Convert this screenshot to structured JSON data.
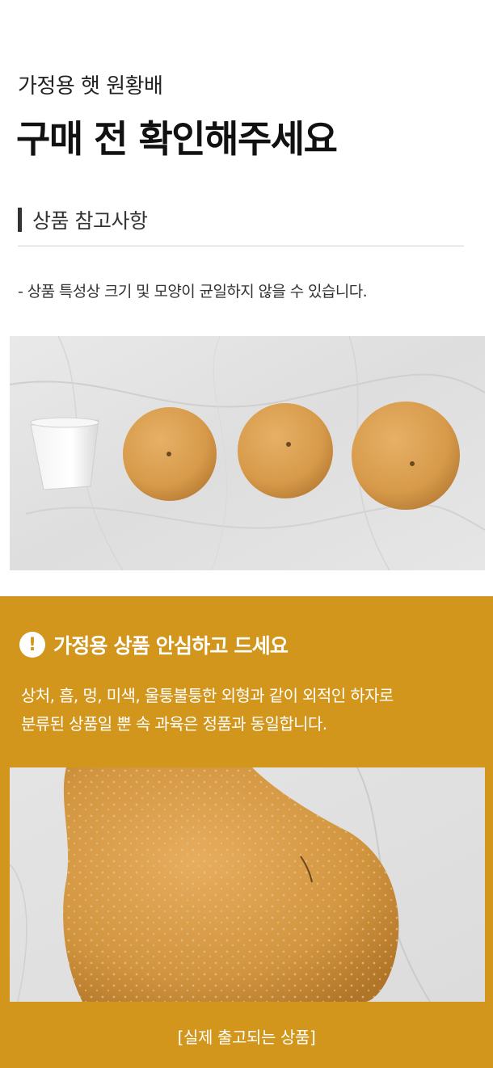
{
  "header": {
    "subtitle": "가정용 햇 원황배",
    "title": "구매 전 확인해주세요"
  },
  "section": {
    "label": "상품 참고사항"
  },
  "note": "- 상품 특성상 크기 및 모양이 균일하지 않을 수 있습니다.",
  "notice": {
    "icon": "exclamation-icon",
    "title": "가정용 상품 안심하고 드세요",
    "line1": "상처, 흠, 멍, 미색, 울퉁불퉁한 외형과 같이 외적인 하자로",
    "line2": "분류된 상품일 뿐 속 과육은 정품과 동일합니다."
  },
  "caption": "[실제 출고되는 상품]",
  "colors": {
    "accent": "#d3961c",
    "text": "#222222",
    "pear": "#d79a4a"
  }
}
